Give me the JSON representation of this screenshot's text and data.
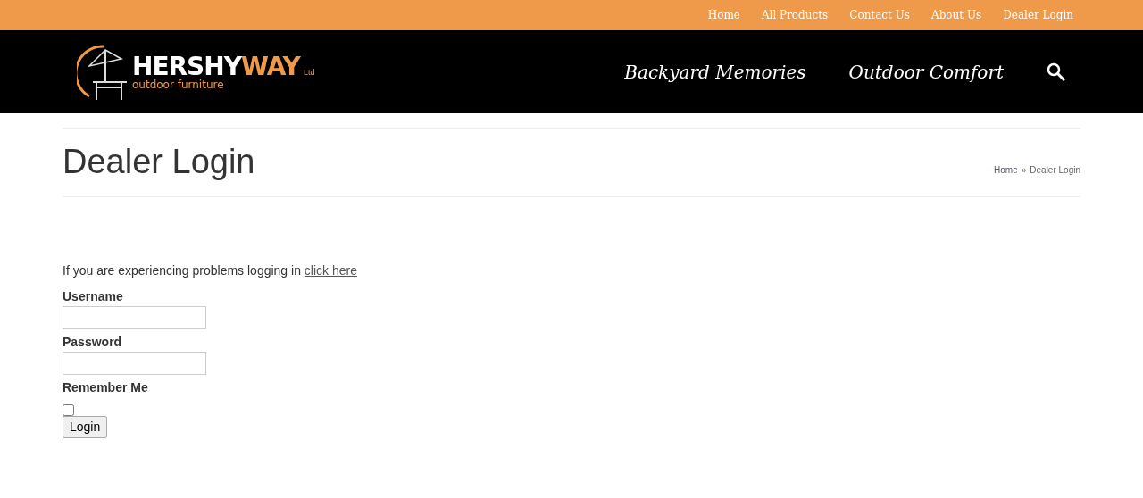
{
  "top_nav": [
    {
      "label": "Home"
    },
    {
      "label": "All Products"
    },
    {
      "label": "Contact Us"
    },
    {
      "label": "About Us"
    },
    {
      "label": "Dealer Login"
    }
  ],
  "logo": {
    "name_primary": "HERSHY",
    "name_accent": "WAY",
    "suffix": "Ltd",
    "tagline": "outdoor furniture"
  },
  "main_nav": [
    {
      "label": "Backyard Memories"
    },
    {
      "label": "Outdoor Comfort"
    }
  ],
  "page_title": "Dealer Login",
  "breadcrumb": {
    "separator": "»",
    "items": [
      {
        "label": "Home",
        "link": true
      },
      {
        "label": "Dealer Login",
        "link": false
      }
    ]
  },
  "help": {
    "text": "If you are experiencing problems logging in",
    "link": "click here"
  },
  "form": {
    "fields": [
      {
        "kind": "text",
        "label": "Username"
      },
      {
        "kind": "password",
        "label": "Password"
      },
      {
        "kind": "checkbox",
        "label": "Remember Me",
        "checked": false
      }
    ],
    "button": "Login"
  }
}
